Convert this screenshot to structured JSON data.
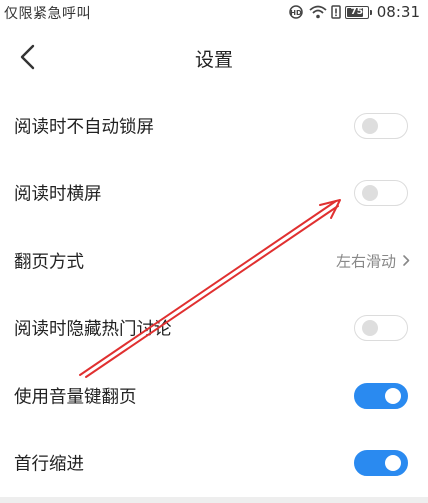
{
  "status_bar": {
    "carrier_text": "仅限紧急呼叫",
    "battery_level": "75",
    "time": "08:31"
  },
  "header": {
    "title": "设置"
  },
  "settings": [
    {
      "label": "阅读时不自动锁屏",
      "type": "toggle",
      "state": "off"
    },
    {
      "label": "阅读时横屏",
      "type": "toggle",
      "state": "off"
    },
    {
      "label": "翻页方式",
      "type": "select",
      "value": "左右滑动"
    },
    {
      "label": "阅读时隐藏热门讨论",
      "type": "toggle",
      "state": "off"
    },
    {
      "label": "使用音量键翻页",
      "type": "toggle",
      "state": "on"
    },
    {
      "label": "首行缩进",
      "type": "toggle",
      "state": "on"
    }
  ],
  "colors": {
    "toggle_on": "#2a8af0",
    "annotation_arrow": "#e03030"
  },
  "icons": {
    "back": "chevron-left-icon",
    "select_arrow": "chevron-right-icon"
  }
}
